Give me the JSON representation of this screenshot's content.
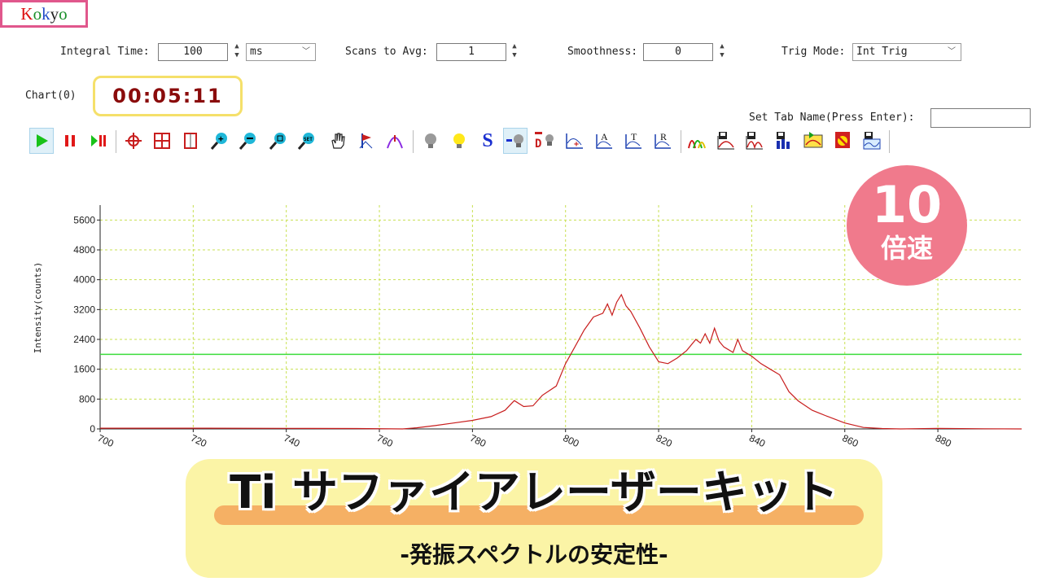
{
  "logo": {
    "k": "K",
    "o1": "o",
    "k2": "k",
    "y": "y",
    "o2": "o"
  },
  "controls": {
    "integral_time_label": "Integral Time:",
    "integral_time_value": "100",
    "integral_unit": "ms",
    "scans_label": "Scans to Avg:",
    "scans_value": "1",
    "smoothness_label": "Smoothness:",
    "smoothness_value": "0",
    "trig_mode_label": "Trig Mode:",
    "trig_mode_value": "Int Trig",
    "chart_label": "Chart(0)",
    "timer": "00:05:11",
    "set_tab_name_label": "Set Tab Name(Press Enter):",
    "set_tab_name_value": ""
  },
  "toolbar": {
    "icons": [
      "play-icon",
      "pause-icon",
      "step-icon",
      "crosshair-icon",
      "grid-icon",
      "bracket-icon",
      "zoom-in-icon",
      "zoom-out-icon",
      "zoom-box-icon",
      "zoom-set-icon",
      "hand-icon",
      "peak-flag-icon",
      "peak-mark-icon",
      "bulb-off-icon",
      "bulb-on-icon",
      "s-icon",
      "dark-bulb-icon",
      "dark-subtract-icon",
      "spectrum-plus-icon",
      "absorbance-icon",
      "transmittance-icon",
      "reflectance-icon",
      "colored-peaks-icon",
      "save-spectrum-icon",
      "save-peaks-icon",
      "save-bars-icon",
      "export-icon",
      "record-icon",
      "save-wave-icon"
    ],
    "text_a": "A",
    "text_t": "T",
    "text_r": "R",
    "text_s": "S",
    "text_set": "SET",
    "text_d": "D"
  },
  "badge": {
    "number": "10",
    "text": "倍速"
  },
  "banner": {
    "title": "Ti サファイアレーザーキット",
    "subtitle": "-発振スペクトルの安定性-"
  },
  "colors": {
    "spectrum": "#c81e1e",
    "threshold": "#3ddc3d",
    "grid": "#c8e050",
    "badge": "#f07a8c",
    "banner": "#fbf4a6",
    "stripe": "#f5b064"
  },
  "chart_data": {
    "type": "line",
    "title": "",
    "xlabel": "",
    "ylabel": "Intensity(counts)",
    "xlim": [
      700,
      898
    ],
    "ylim": [
      0,
      6000
    ],
    "x_ticks": [
      700,
      720,
      740,
      760,
      780,
      800,
      820,
      840,
      860,
      880
    ],
    "y_ticks": [
      0,
      800,
      1600,
      2400,
      3200,
      4000,
      4800,
      5600
    ],
    "grid": true,
    "threshold": 2000,
    "series": [
      {
        "x": [
          700,
          720,
          740,
          755,
          765,
          768,
          772,
          776,
          780,
          784,
          787,
          789,
          791,
          793,
          795,
          798,
          800,
          802,
          804,
          806,
          808,
          809,
          810,
          811,
          812,
          813,
          814,
          816,
          818,
          820,
          822,
          824,
          826,
          828,
          829,
          830,
          831,
          832,
          833,
          834,
          836,
          837,
          838,
          840,
          842,
          844,
          846,
          848,
          850,
          853,
          856,
          860,
          864,
          868,
          872,
          880,
          890,
          898
        ],
        "y": [
          20,
          20,
          15,
          10,
          0,
          30,
          90,
          160,
          230,
          330,
          500,
          760,
          600,
          620,
          900,
          1150,
          1750,
          2200,
          2650,
          3000,
          3100,
          3350,
          3050,
          3400,
          3600,
          3300,
          3150,
          2700,
          2200,
          1800,
          1750,
          1900,
          2100,
          2400,
          2300,
          2550,
          2300,
          2700,
          2350,
          2200,
          2050,
          2400,
          2100,
          1950,
          1750,
          1600,
          1450,
          1000,
          750,
          500,
          350,
          160,
          40,
          10,
          0,
          15,
          5,
          0
        ]
      }
    ]
  }
}
